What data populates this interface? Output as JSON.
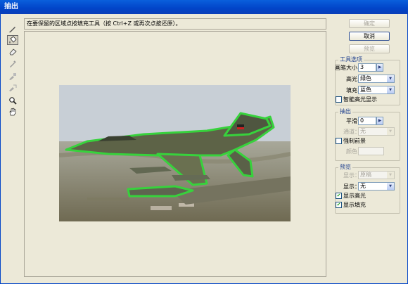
{
  "window": {
    "title": "抽出"
  },
  "instruction": "在要保留的区域点按填充工具（按 Ctrl+Z 或再次点按还原）。",
  "buttons": {
    "ok": "确定",
    "cancel": "取消",
    "preview": "预览"
  },
  "tool_options": {
    "title": "工具选项",
    "brush_size_label": "画笔大小：",
    "brush_size_value": "3",
    "highlight_label": "高光：",
    "highlight_value": "绿色",
    "fill_label": "填充：",
    "fill_value": "蓝色",
    "smart_highlight_label": "智能高光显示"
  },
  "extraction": {
    "title": "抽出",
    "smooth_label": "平滑：",
    "smooth_value": "0",
    "channel_label": "通道：",
    "channel_value": "无",
    "force_foreground_label": "强制前景",
    "color_label": "颜色："
  },
  "preview_group": {
    "title": "预览",
    "show_label": "显示：",
    "show_value": "原稿",
    "display_label": "显示：",
    "display_value": "无",
    "show_highlight_label": "显示高光",
    "show_highlight_checked": true,
    "show_fill_label": "显示填充",
    "show_fill_checked": true
  },
  "icons": [
    "edge-highlighter-icon",
    "fill-icon",
    "eraser-icon",
    "eyedropper-icon",
    "cleanup-icon",
    "edge-touchup-icon",
    "zoom-icon",
    "hand-icon"
  ],
  "colors": {
    "titlebar": "#0144c8",
    "highlight_outline": "#37d23c",
    "group_title": "#1e3f8e"
  }
}
